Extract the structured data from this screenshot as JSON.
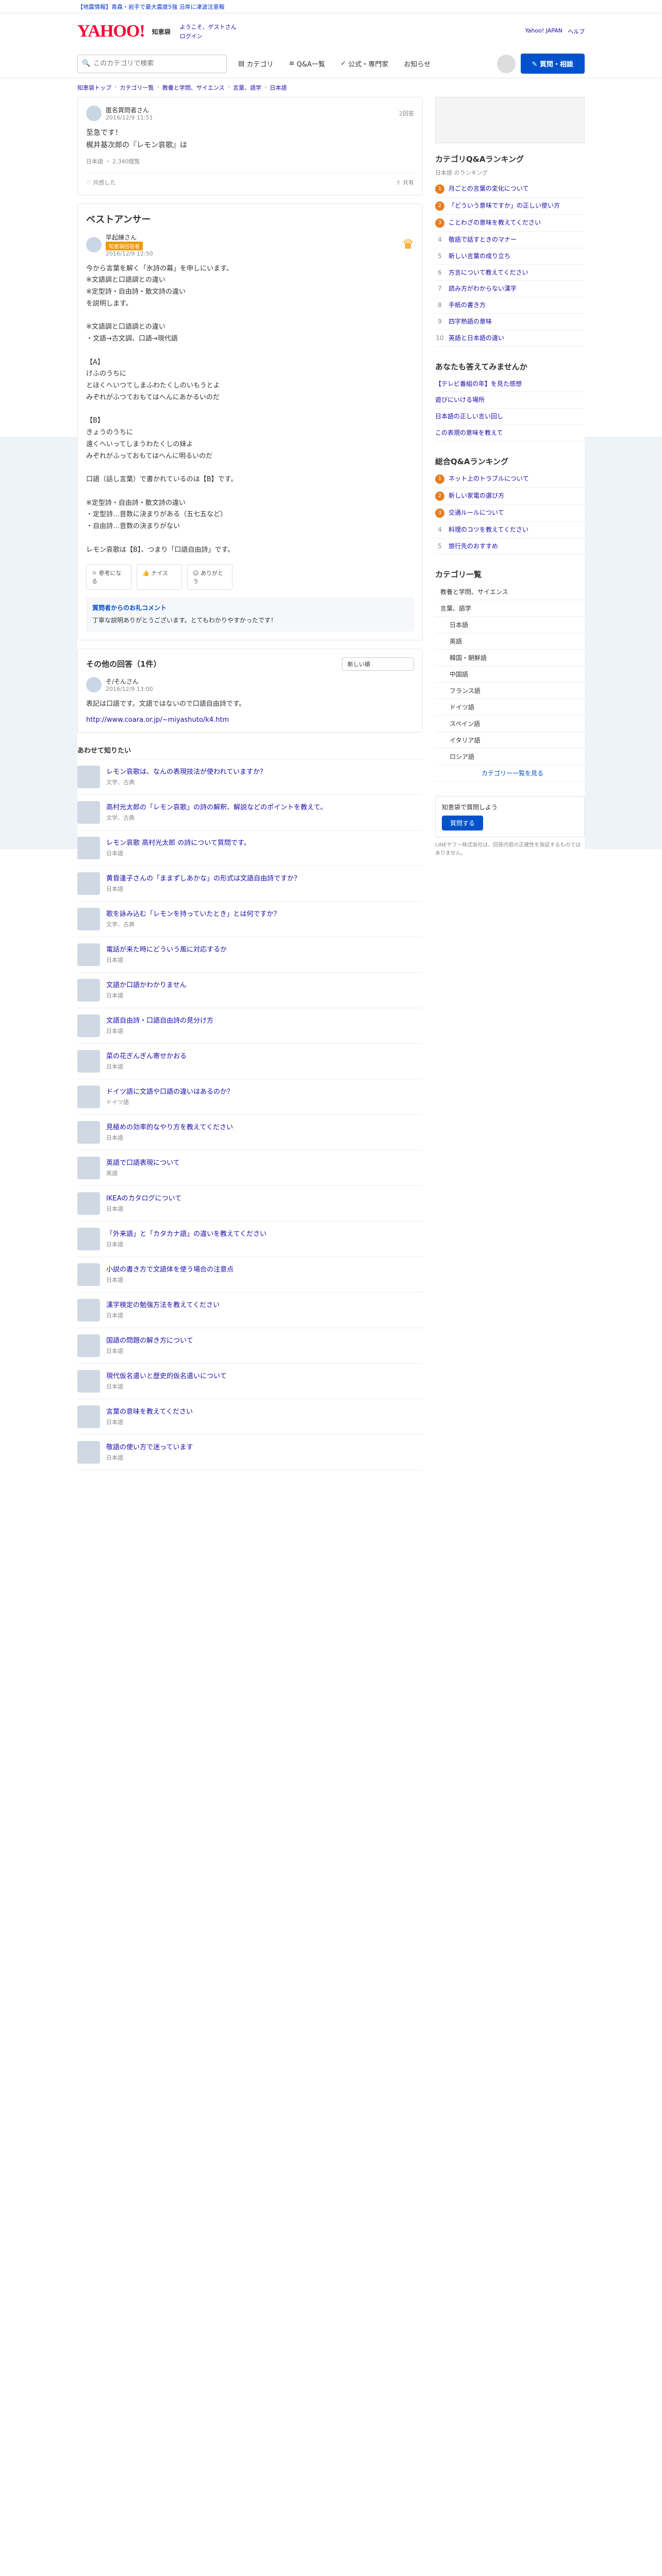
{
  "topbar": {
    "ticker": "【地震情報】青森・岩手で最大震度5強 沿岸に津波注意報"
  },
  "header": {
    "logo": "YAHOO!",
    "service": "知恵袋",
    "links": [
      "ようこそ、ゲストさん",
      "ログイン"
    ],
    "right_links": [
      "Yahoo! JAPAN",
      "ヘルプ"
    ]
  },
  "nav": {
    "search_placeholder": "このカテゴリで検索",
    "tabs": [
      "カテゴリ",
      "Q&A一覧",
      "公式・専門家",
      "お知らせ"
    ],
    "ask_button": "質問・相談"
  },
  "breadcrumb": [
    "知恵袋トップ",
    "カテゴリ一覧",
    "教養と学問、サイエンス",
    "言葉、語学",
    "日本語"
  ],
  "question": {
    "user": "匿名質問者さん",
    "date": "2016/12/9 11:51",
    "answers_count": "2回答",
    "body": "至急です！\n梶井基次郎の『レモン哀歌』は",
    "tags": "日本語 ・ 2,340閲覧",
    "share_label": "共有",
    "follow_label": "共感した"
  },
  "best_answer": {
    "heading": "ベストアンサー",
    "user": "早起練さん",
    "badge": "知恵袋回答者",
    "date": "2016/12/9 12:50",
    "text": "今から言葉を解く「氷詩の幕」を申しにいます。\n※文語調と口語調との違い\n※定型詩・自由詩・散文詩の違い\nを説明します。\n\n※文語調と口語調との違い\n・文語→古文調、口語→現代語\n\n【A】\nけふのうちに\nとほくへいつてしまふわたくしのいもうとよ\nみぞれがふつておもてはへんにあかるいのだ\n\n【B】\nきょうのうちに\n遠くへいってしまうわたくしの妹よ\nみぞれがふっておもてはへんに明るいのだ\n\n口語（話し言葉）で書かれているのは【B】です。\n\n※定型詩・自由詩・散文詩の違い\n・定型詩…音数に決まりがある（五七五など）\n・自由詩…音数の決まりがない\n\nレモン哀歌は【B】、つまり「口語自由詩」です。",
    "reactions": [
      "参考になる",
      "ナイス",
      "ありがとう"
    ]
  },
  "boost": {
    "title": "質問者からのお礼コメント",
    "text": "丁寧な説明ありがとうございます。とてもわかりやすかったです！"
  },
  "other_answers": {
    "heading": "その他の回答（1件）",
    "sort": "新しい順",
    "user": "そ/そんさん",
    "date": "2016/12/9 13:00",
    "text": "表記は口語です。文語ではないので口語自由詩です。",
    "link": "http://www.coara.or.jp/~miyashuto/k4.htm"
  },
  "recommend": {
    "heading": "あわせて知りたい",
    "items": [
      {
        "title": "レモン哀歌は、なんの表現技法が使われていますか？",
        "cat": "文学、古典"
      },
      {
        "title": "高村光太郎の「レモン哀歌」の詩の解釈、解説などのポイントを教えて。",
        "cat": "文学、古典"
      },
      {
        "title": "レモン哀歌 高村光太郎 の詩について質問です。",
        "cat": "日本語"
      },
      {
        "title": "黄昏逢子さんの「ままずしあかな」の形式は文語自由詩ですか？",
        "cat": "日本語"
      },
      {
        "title": "歌を詠み込む「レモンを持っていたとき」とは何ですか？",
        "cat": "文学、古典"
      },
      {
        "title": "電話が来た時にどういう風に対応するか",
        "cat": "日本語"
      },
      {
        "title": "文語か口語かわかりません",
        "cat": "日本語"
      },
      {
        "title": "文語自由詩・口語自由詩の見分け方",
        "cat": "日本語"
      },
      {
        "title": "菜の花ぎんぎん寄せかおる",
        "cat": "日本語"
      },
      {
        "title": "ドイツ語に文語や口語の違いはあるのか？",
        "cat": "ドイツ語"
      },
      {
        "title": "見極めの効率的なやり方を教えてください",
        "cat": "日本語"
      },
      {
        "title": "英語で口語表現について",
        "cat": "英語"
      },
      {
        "title": "IKEAのカタログについて",
        "cat": "日本語"
      },
      {
        "title": "「外来語」と「カタカナ語」の違いを教えてください",
        "cat": "日本語"
      },
      {
        "title": "小説の書き方で文語体を使う場合の注意点",
        "cat": "日本語"
      },
      {
        "title": "漢字検定の勉強方法を教えてください",
        "cat": "日本語"
      },
      {
        "title": "国語の問題の解き方について",
        "cat": "日本語"
      },
      {
        "title": "現代仮名遣いと歴史的仮名遣いについて",
        "cat": "日本語"
      },
      {
        "title": "言葉の意味を教えてください",
        "cat": "日本語"
      },
      {
        "title": "敬語の使い方で迷っています",
        "cat": "日本語"
      }
    ]
  },
  "sidebar": {
    "ranking_title": "カテゴリQ&Aランキング",
    "ranking_sub": "日本語 のランキング",
    "ranking": [
      "月ごとの言葉の変化について",
      "「どういう意味ですか」の正しい使い方",
      "ことわざの意味を教えてください",
      "敬語で話すときのマナー",
      "新しい言葉の成り立ち",
      "方言について教えてください",
      "読み方がわからない漢字",
      "手紙の書き方",
      "四字熟語の意味",
      "英語と日本語の違い"
    ],
    "recommend_title": "あなたも答えてみませんか",
    "recommend_items": [
      "【テレビ番組の年】を見た感想",
      "遊びにいける場所",
      "日本語の正しい言い回し",
      "この表現の意味を教えて"
    ],
    "general_title": "総合Q&Aランキング",
    "general_items": [
      "ネット上のトラブルについて",
      "新しい家電の選び方",
      "交通ルールについて",
      "料理のコツを教えてください",
      "旅行先のおすすめ"
    ],
    "category_title": "カテゴリ一覧",
    "categories": [
      "教養と学問、サイエンス",
      "言葉、語学"
    ],
    "sub_categories": [
      "日本語",
      "英語",
      "韓国・朝鮮語",
      "中国語",
      "フランス語",
      "ドイツ語",
      "スペイン語",
      "イタリア語",
      "ロシア語"
    ],
    "more": "カテゴリー一覧を見る",
    "promo_text": "知恵袋で質問しよう",
    "promo_button": "質問する",
    "note": "LINEヤフー株式会社は、回答内容の正確性を保証するものではありません。"
  }
}
